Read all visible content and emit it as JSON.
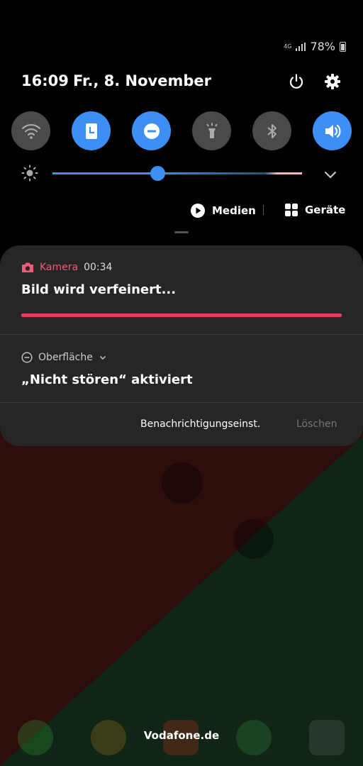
{
  "status_bar": {
    "network": "4G",
    "battery": "78%",
    "icons": [
      "signal-icon",
      "battery-icon"
    ]
  },
  "header": {
    "time": "16:09",
    "date": "Fr., 8. November",
    "icons": [
      "power-icon",
      "settings-gear-icon"
    ]
  },
  "quick_toggles": [
    {
      "name": "wifi",
      "icon": "wifi-icon",
      "active": false
    },
    {
      "name": "screen-timeout",
      "icon": "portrait-lock-icon",
      "active": true
    },
    {
      "name": "do-not-disturb",
      "icon": "minus-circle-icon",
      "active": true
    },
    {
      "name": "flashlight",
      "icon": "flashlight-icon",
      "active": false
    },
    {
      "name": "bluetooth",
      "icon": "bluetooth-icon",
      "active": false
    },
    {
      "name": "sound",
      "icon": "volume-icon",
      "active": true
    }
  ],
  "brightness": {
    "level": 0.42,
    "icon": "sun-icon"
  },
  "media": {
    "label": "Medien",
    "icon": "play-icon"
  },
  "devices": {
    "label": "Geräte",
    "icon": "grid-icon"
  },
  "notifications": [
    {
      "app": "Kamera",
      "time": "00:34",
      "icon": "camera-icon",
      "title": "Bild wird verfeinert...",
      "progress": 1.0
    },
    {
      "app": "Oberfläche",
      "icon": "minus-circle-icon",
      "title": "„Nicht stören“ aktiviert"
    }
  ],
  "footer": {
    "settings_label": "Benachrichtigungseinst.",
    "clear_label": "Löschen"
  },
  "dock": {
    "carrier_label": "Vodafone.de"
  },
  "colors": {
    "accent": "#3d8ff5",
    "camera": "#ef5a7a",
    "progress": "#d7455f",
    "panel": "#262626"
  }
}
